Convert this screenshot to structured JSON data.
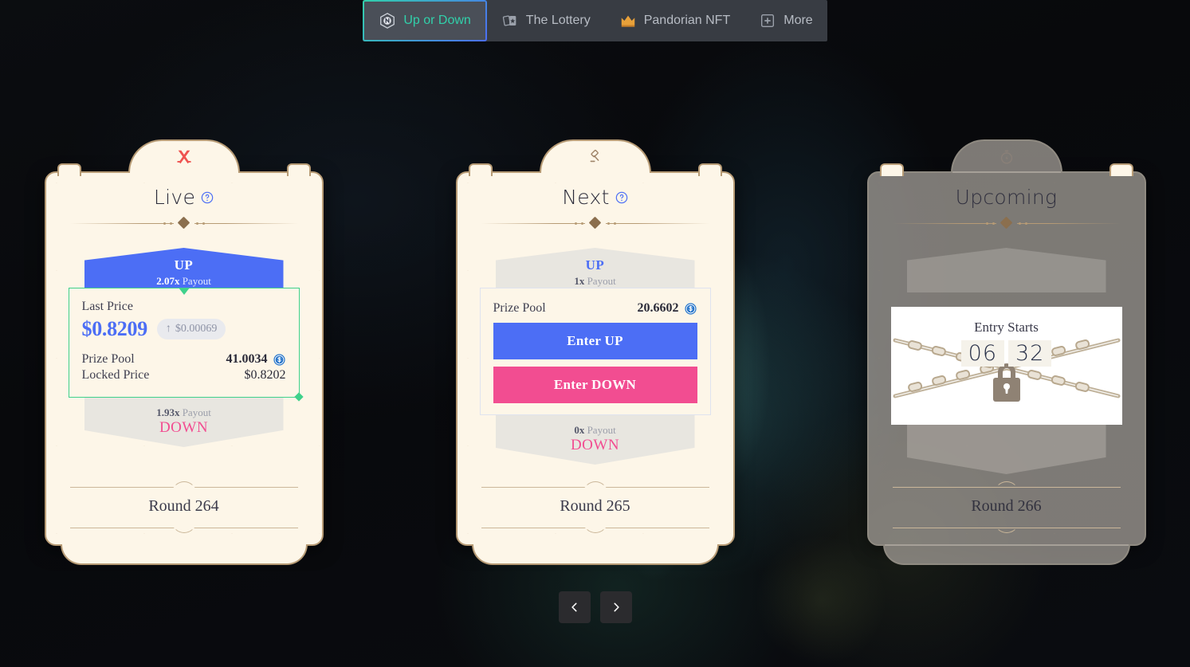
{
  "nav": {
    "tabs": [
      {
        "label": "Up or Down",
        "icon": "hexagon-coin-icon",
        "active": true
      },
      {
        "label": "The Lottery",
        "icon": "cards-icon",
        "active": false
      },
      {
        "label": "Pandorian NFT",
        "icon": "crown-icon",
        "active": false
      },
      {
        "label": "More",
        "icon": "plus-square-icon",
        "active": false
      }
    ]
  },
  "cards": [
    {
      "id": "live",
      "state": "live",
      "top_icon": "crossed-swords-icon",
      "title": "Live",
      "help_icon": "question-circle-icon",
      "up": {
        "label": "UP",
        "multiplier": "2.07x",
        "payout_word": "Payout"
      },
      "down": {
        "label": "DOWN",
        "multiplier": "1.93x",
        "payout_word": "Payout"
      },
      "last_price_label": "Last Price",
      "last_price_value": "$0.8209",
      "delta_arrow": "↑",
      "delta_value": "$0.00069",
      "prize_pool_label": "Prize Pool",
      "prize_pool_value": "41.0034",
      "prize_pool_icon": "coin-icon",
      "locked_price_label": "Locked Price",
      "locked_price_value": "$0.8202",
      "round_label": "Round 264"
    },
    {
      "id": "next",
      "state": "next",
      "top_icon": "gavel-icon",
      "title": "Next",
      "help_icon": "question-circle-icon",
      "up": {
        "label": "UP",
        "multiplier": "1x",
        "payout_word": "Payout"
      },
      "down": {
        "label": "DOWN",
        "multiplier": "0x",
        "payout_word": "Payout"
      },
      "prize_pool_label": "Prize Pool",
      "prize_pool_value": "20.6602",
      "prize_pool_icon": "coin-icon",
      "enter_up_label": "Enter UP",
      "enter_down_label": "Enter DOWN",
      "round_label": "Round 265"
    },
    {
      "id": "upcoming",
      "state": "locked",
      "top_icon": "stopwatch-bolt-icon",
      "title": "Upcoming",
      "entry_starts_label": "Entry Starts",
      "countdown_minutes": "06",
      "countdown_seconds": "32",
      "lock_icon": "padlock-icon",
      "round_label": "Round 266"
    }
  ],
  "pager": {
    "prev_label": "chevron-left-icon",
    "next_label": "chevron-right-icon"
  },
  "colors": {
    "accent_green": "#31d0aa",
    "up_blue": "#4c6ef5",
    "down_pink": "#f24d91",
    "card_cream": "#fdf6e8",
    "frame_gold": "#b79b75",
    "live_border": "#3fd18b",
    "page_bg": "#0a0a0c"
  }
}
